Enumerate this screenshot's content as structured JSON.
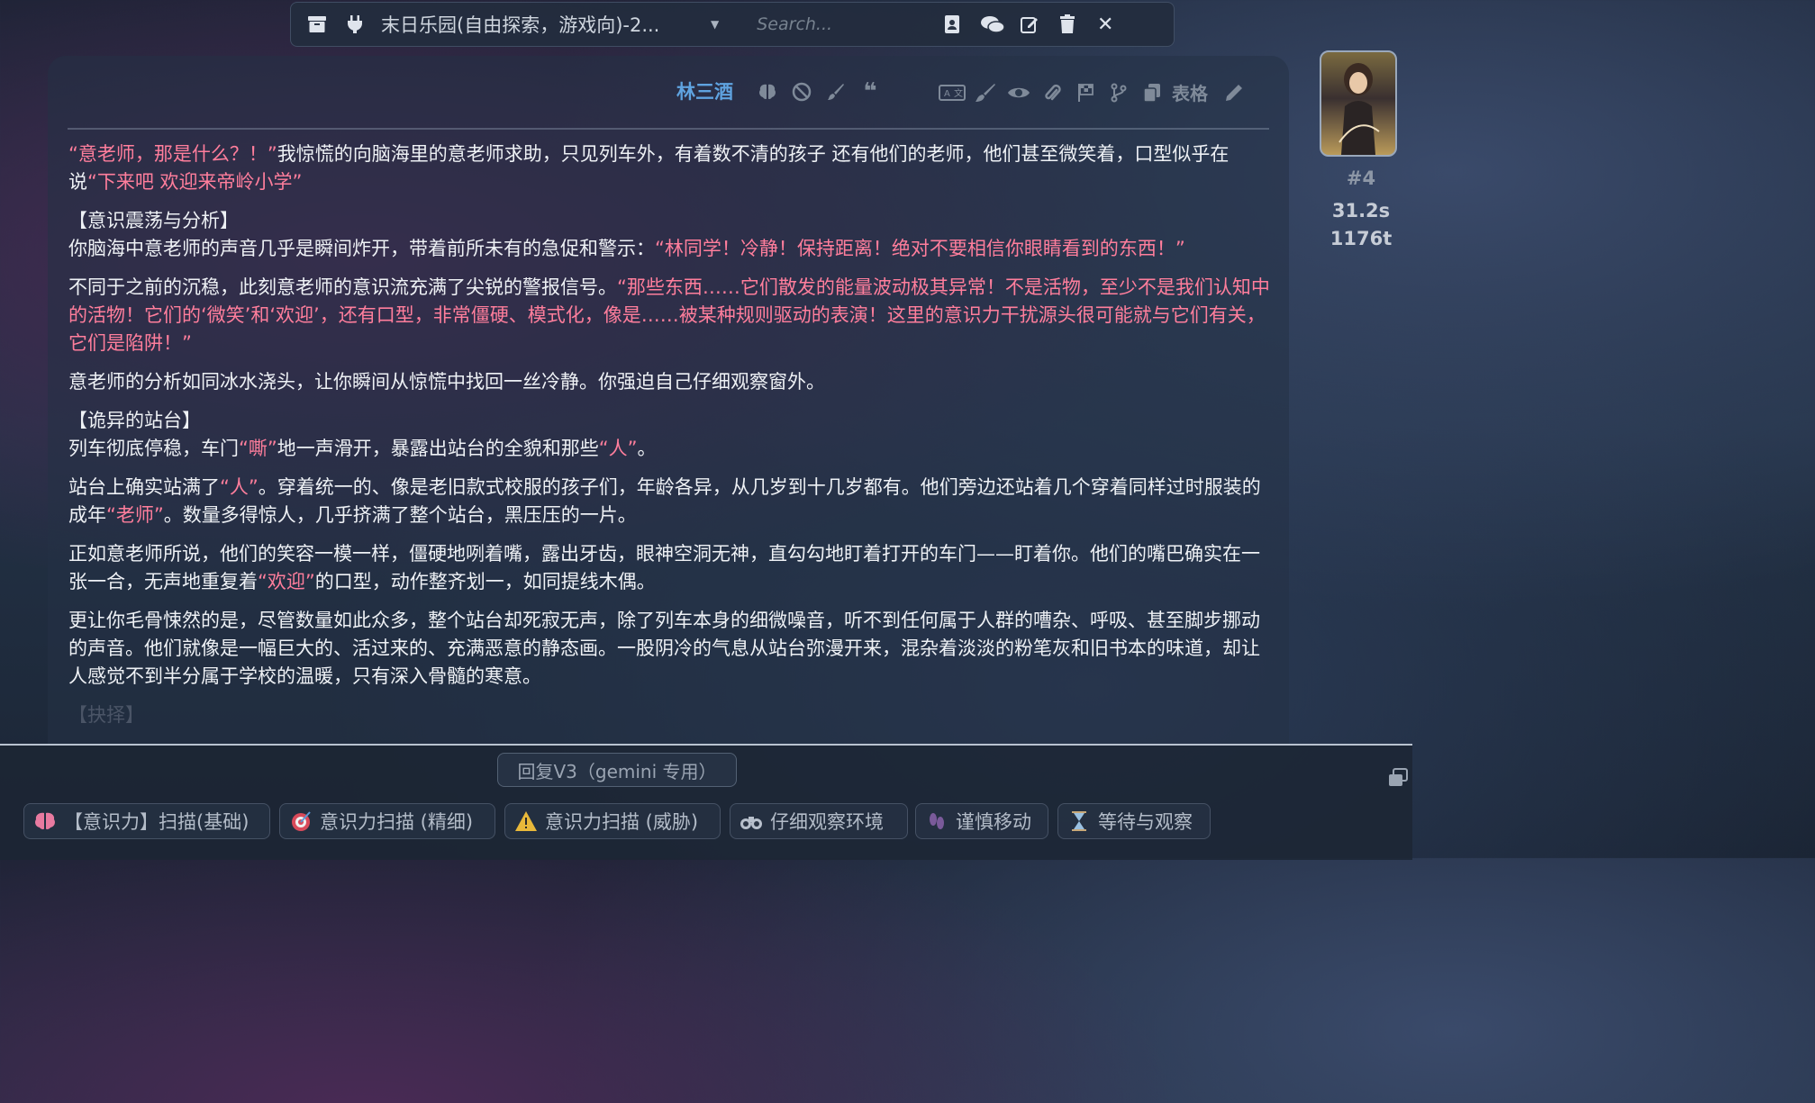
{
  "top_bar": {
    "chat_title": "末日乐园(自由探索，游戏向)-2...",
    "search_placeholder": "Search..."
  },
  "message": {
    "character_name": "林三酒",
    "table_label": "表格",
    "id": "#4",
    "time": "31.2s",
    "tokens": "1176t",
    "paragraphs": {
      "p1_q1": "“意老师，那是什么？！”",
      "p1_t1": "我惊慌的向脑海里的意老师求助，只见列车外，有着数不清的孩子 还有他们的老师，他们甚至微笑着，口型似乎在说",
      "p1_q2": "“下来吧 欢迎来帝岭小学”",
      "s1": "【意识震荡与分析】",
      "p2_t1": "你脑海中意老师的声音几乎是瞬间炸开，带着前所未有的急促和警示：",
      "p2_q1": "“林同学！冷静！保持距离！绝对不要相信你眼睛看到的东西！”",
      "p3_t1": "不同于之前的沉稳，此刻意老师的意识流充满了尖锐的警报信号。",
      "p3_q1": "“那些东西……它们散发的能量波动极其异常！不是活物，至少不是我们认知中的活物！它们的‘微笑’和‘欢迎’，还有口型，非常僵硬、模式化，像是……被某种规则驱动的表演！这里的意识力干扰源头很可能就与它们有关，它们是陷阱！”",
      "p4": "意老师的分析如同冰水浇头，让你瞬间从惊慌中找回一丝冷静。你强迫自己仔细观察窗外。",
      "s2": "【诡异的站台】",
      "p5_t1": "列车彻底停稳，车门",
      "p5_q1": "“嘶”",
      "p5_t2": "地一声滑开，暴露出站台的全貌和那些",
      "p5_q2": "“人”",
      "p5_t3": "。",
      "p6_t1": "站台上确实站满了",
      "p6_q1": "“人”",
      "p6_t2": "。穿着统一的、像是老旧款式校服的孩子们，年龄各异，从几岁到十几岁都有。他们旁边还站着几个穿着同样过时服装的成年",
      "p6_q2": "“老师”",
      "p6_t3": "。数量多得惊人，几乎挤满了整个站台，黑压压的一片。",
      "p7_t1": "正如意老师所说，他们的笑容一模一样，僵硬地咧着嘴，露出牙齿，眼神空洞无神，直勾勾地盯着打开的车门——盯着你。他们的嘴巴确实在一张一合，无声地重复着",
      "p7_q1": "“欢迎”",
      "p7_t2": "的口型，动作整齐划一，如同提线木偶。",
      "p8": "更让你毛骨悚然的是，尽管数量如此众多，整个站台却死寂无声，除了列车本身的细微噪音，听不到任何属于人群的嘈杂、呼吸、甚至脚步挪动的声音。他们就像是一幅巨大的、活过来的、充满恶意的静态画。一股阴冷的气息从站台弥漫开来，混杂着淡淡的粉笔灰和旧书本的味道，却让人感觉不到半分属于学校的温暖，只有深入骨髓的寒意。",
      "s3": "【抉择】"
    }
  },
  "bottom": {
    "reply_label": "回复V3（gemini 专用）",
    "quick_replies": [
      "【意识力】扫描(基础)",
      "意识力扫描 (精细)",
      "意识力扫描 (威胁)",
      "仔细观察环境",
      "谨慎移动",
      "等待与观察"
    ]
  },
  "colors": {
    "quote": "#ff7e9c",
    "char_name": "#5fa3e0",
    "text": "#eef1f5"
  }
}
